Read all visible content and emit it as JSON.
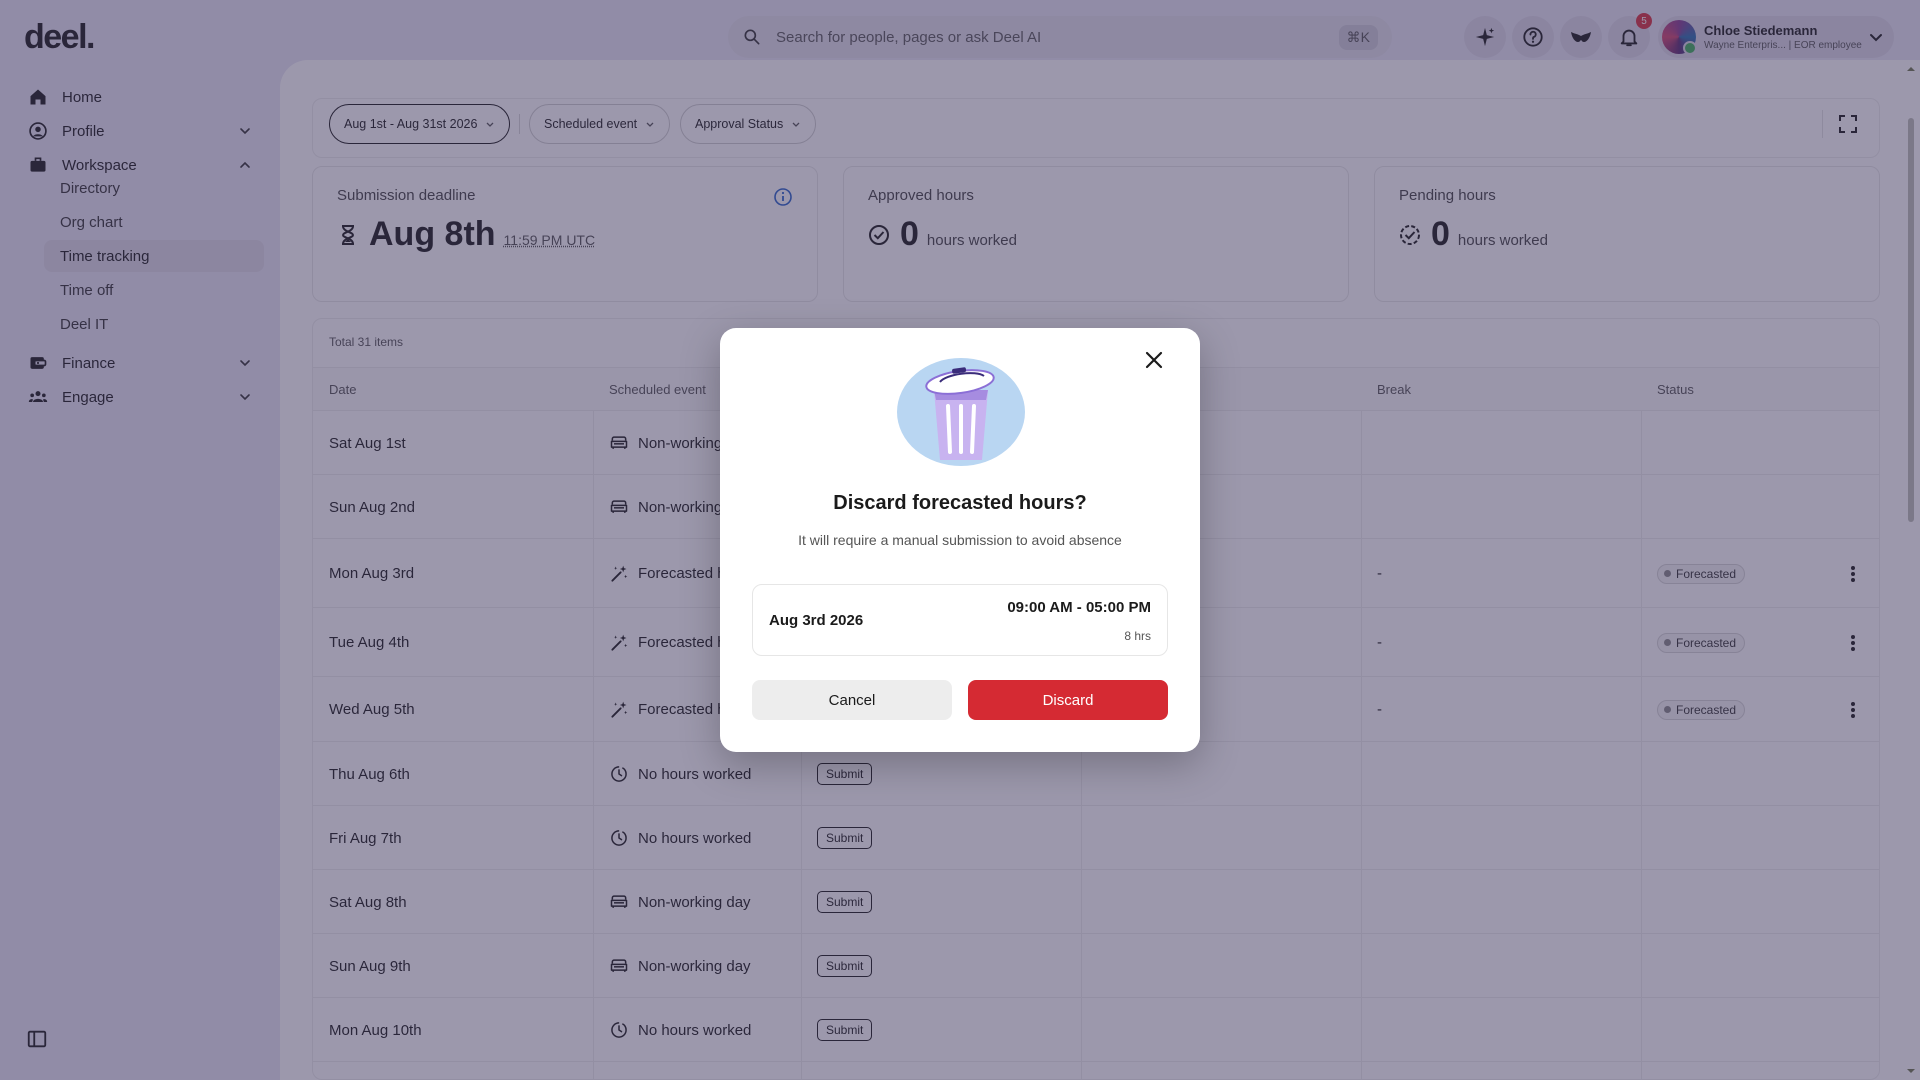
{
  "app": {
    "logo": "deel."
  },
  "search": {
    "placeholder": "Search for people, pages or ask Deel AI",
    "shortcut": "⌘K"
  },
  "topbar": {
    "notifications_count": "5"
  },
  "user": {
    "name": "Chloe Stiedemann",
    "subtitle": "Wayne Enterpris... | EOR employee"
  },
  "sidebar": {
    "items": [
      {
        "label": "Home",
        "icon": "home-icon"
      },
      {
        "label": "Profile",
        "icon": "profile-icon",
        "expanded": false
      },
      {
        "label": "Workspace",
        "icon": "briefcase-icon",
        "expanded": true
      },
      {
        "label": "Finance",
        "icon": "finance-icon",
        "expanded": false
      },
      {
        "label": "Engage",
        "icon": "people-icon",
        "expanded": false
      }
    ],
    "workspace_sub": [
      "Directory",
      "Org chart",
      "Time tracking",
      "Time off",
      "Deel IT"
    ],
    "active_sub": "Time tracking"
  },
  "filters": {
    "date_range": "Aug 1st - Aug 31st 2026",
    "scheduled_event": "Scheduled event",
    "approval_status": "Approval Status"
  },
  "cards": {
    "deadline": {
      "title": "Submission deadline",
      "date": "Aug 8th",
      "time": "11:59 PM UTC"
    },
    "approved": {
      "title": "Approved hours",
      "value": "0",
      "unit": "hours worked"
    },
    "pending": {
      "title": "Pending hours",
      "value": "0",
      "unit": "hours worked"
    }
  },
  "table": {
    "total": "Total 31 items",
    "columns": [
      "Date",
      "Scheduled event",
      "Break",
      "Status"
    ],
    "rows": [
      {
        "date": "Sat Aug 1st",
        "event": "Non-working day",
        "event_icon": "sofa-icon",
        "break": "",
        "status": "",
        "action": ""
      },
      {
        "date": "Sun Aug 2nd",
        "event": "Non-working day",
        "event_icon": "sofa-icon",
        "break": "",
        "status": "",
        "action": ""
      },
      {
        "date": "Mon Aug 3rd",
        "event": "Forecasted hours",
        "event_icon": "magic-wand-icon",
        "break": "-",
        "status": "Forecasted",
        "action": ""
      },
      {
        "date": "Tue Aug 4th",
        "event": "Forecasted hours",
        "event_icon": "magic-wand-icon",
        "break": "-",
        "status": "Forecasted",
        "action": ""
      },
      {
        "date": "Wed Aug 5th",
        "event": "Forecasted hours",
        "event_icon": "magic-wand-icon",
        "break": "-",
        "status": "Forecasted",
        "action": ""
      },
      {
        "date": "Thu Aug 6th",
        "event": "No hours worked",
        "event_icon": "clock-icon",
        "break": "",
        "status": "",
        "action": "Submit"
      },
      {
        "date": "Fri Aug 7th",
        "event": "No hours worked",
        "event_icon": "clock-icon",
        "break": "",
        "status": "",
        "action": "Submit"
      },
      {
        "date": "Sat Aug 8th",
        "event": "Non-working day",
        "event_icon": "sofa-icon",
        "break": "",
        "status": "",
        "action": "Submit"
      },
      {
        "date": "Sun Aug 9th",
        "event": "Non-working day",
        "event_icon": "sofa-icon",
        "break": "",
        "status": "",
        "action": "Submit"
      },
      {
        "date": "Mon Aug 10th",
        "event": "No hours worked",
        "event_icon": "clock-icon",
        "break": "",
        "status": "",
        "action": "Submit"
      }
    ]
  },
  "modal": {
    "title": "Discard forecasted hours?",
    "description": "It will require a manual submission to avoid absence",
    "entry_date": "Aug 3rd 2026",
    "entry_time": "09:00 AM - 05:00 PM",
    "entry_hours": "8 hrs",
    "cancel_label": "Cancel",
    "discard_label": "Discard"
  },
  "colors": {
    "accent": "#d52a33",
    "overlay": "#3a325a",
    "sidebar_bg": "#e9e6f5"
  }
}
